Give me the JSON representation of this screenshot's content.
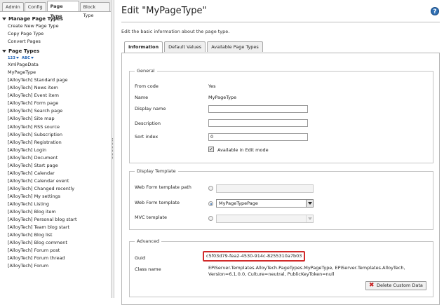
{
  "sidebar": {
    "tabs": [
      {
        "label": "Admin",
        "active": false
      },
      {
        "label": "Config",
        "active": false
      },
      {
        "label": "Page Type",
        "active": true
      },
      {
        "label": "Block Type",
        "active": false
      }
    ],
    "manage_header": "Manage Page Types",
    "manage_items": [
      "Create New Page Type",
      "Copy Page Type",
      "Convert Pages"
    ],
    "page_types_header": "Page Types",
    "sort_numeric": "123",
    "sort_alpha": "ABC",
    "page_types": [
      "XmlPageData",
      "MyPageType",
      "[AlloyTech] Standard page",
      "[AlloyTech] News item",
      "[AlloyTech] Event item",
      "[AlloyTech] Form page",
      "[AlloyTech] Search page",
      "[AlloyTech] Site map",
      "[AlloyTech] RSS source",
      "[AlloyTech] Subscription",
      "[AlloyTech] Registration",
      "[AlloyTech] Login",
      "[AlloyTech] Document",
      "[AlloyTech] Start page",
      "[AlloyTech] Calendar",
      "[AlloyTech] Calendar event",
      "[AlloyTech] Changed recently",
      "[AlloyTech] My settings",
      "[AlloyTech] Listing",
      "[AlloyTech] Blog item",
      "[AlloyTech] Personal blog start",
      "[AlloyTech] Team blog start",
      "[AlloyTech] Blog list",
      "[AlloyTech] Blog comment",
      "[AlloyTech] Forum post",
      "[AlloyTech] Forum thread",
      "[AlloyTech] Forum"
    ]
  },
  "main": {
    "title": "Edit \"MyPageType\"",
    "intro": "Edit the basic information about the page type.",
    "tabs": [
      {
        "label": "Information",
        "active": true
      },
      {
        "label": "Default Values",
        "active": false
      },
      {
        "label": "Available Page Types",
        "active": false
      }
    ],
    "general": {
      "legend": "General",
      "from_code_label": "From code",
      "from_code_value": "Yes",
      "name_label": "Name",
      "name_value": "MyPageType",
      "display_name_label": "Display name",
      "display_name_value": "",
      "description_label": "Description",
      "description_value": "",
      "sort_index_label": "Sort index",
      "sort_index_value": "0",
      "available_label": "Available in Edit mode",
      "available_checked": "✓"
    },
    "display_template": {
      "legend": "Display Template",
      "webform_path_label": "Web Form template path",
      "webform_path_value": "",
      "webform_label": "Web Form template",
      "webform_value": "MyPageTypePage",
      "mvc_label": "MVC template",
      "mvc_value": ""
    },
    "advanced": {
      "legend": "Advanced",
      "guid_label": "Guid",
      "guid_value": "c5f03d79-fea2-4530-914c-8255310a7b03",
      "classname_label": "Class name",
      "classname_line1": "EPiServer.Templates.AlloyTech.PageTypes.MyPageType, EPiServer.Templates.AlloyTech,",
      "classname_line2": "Version=6.1.0.0, Culture=neutral, PublicKeyToken=null",
      "delete_button": "Delete Custom Data"
    }
  },
  "colors": {
    "highlight": "#d12a2a",
    "help_icon": "#2f6fb3",
    "delete_icon": "#c82020"
  }
}
